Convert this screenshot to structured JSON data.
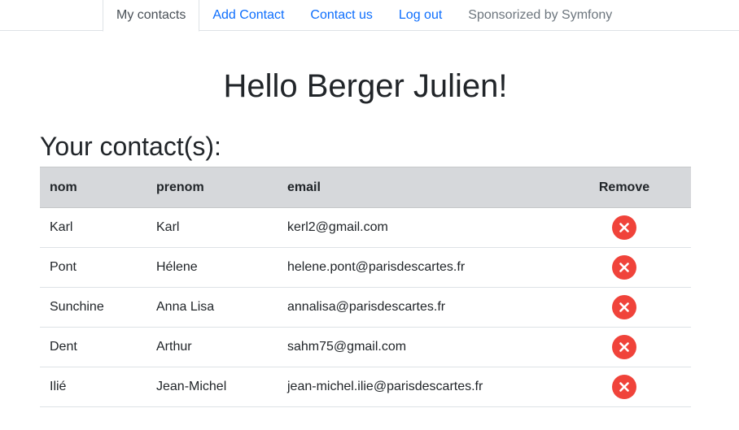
{
  "nav": {
    "tabs": [
      {
        "label": "My contacts"
      },
      {
        "label": "Add Contact"
      },
      {
        "label": "Contact us"
      },
      {
        "label": "Log out"
      },
      {
        "label": "Sponsorized by Symfony"
      }
    ]
  },
  "main": {
    "greeting": "Hello Berger Julien!",
    "subtitle": "Your contact(s):"
  },
  "table": {
    "headers": {
      "nom": "nom",
      "prenom": "prenom",
      "email": "email",
      "remove": "Remove"
    },
    "rows": [
      {
        "nom": "Karl",
        "prenom": "Karl",
        "email": "kerl2@gmail.com"
      },
      {
        "nom": "Pont",
        "prenom": "Hélene",
        "email": "helene.pont@parisdescartes.fr"
      },
      {
        "nom": "Sunchine",
        "prenom": "Anna Lisa",
        "email": "annalisa@parisdescartes.fr"
      },
      {
        "nom": "Dent",
        "prenom": "Arthur",
        "email": "sahm75@gmail.com"
      },
      {
        "nom": "Ilié",
        "prenom": "Jean-Michel",
        "email": "jean-michel.ilie@parisdescartes.fr"
      }
    ],
    "remove_icon": "close-circle-icon",
    "remove_color": "#f0433a"
  },
  "colors": {
    "link": "#0d6efd",
    "header_bg": "#d6d8db"
  }
}
